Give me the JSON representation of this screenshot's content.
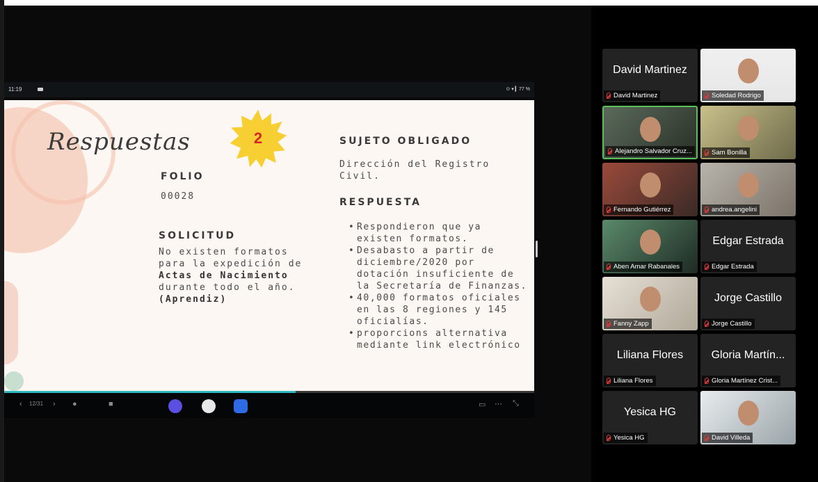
{
  "status_bar": {
    "time": "11:19",
    "right_icons": "⊙ ▾ ▎77 %"
  },
  "slide": {
    "script_title": "Respuestas",
    "number": "2",
    "folio_heading": "FOLIO",
    "folio_value": "00028",
    "solicitud_heading": "SOLICITUD",
    "solicitud_text_1": "No existen formatos para la expedición de ",
    "solicitud_bold_1": "Actas de Nacimiento",
    "solicitud_text_2": " durante todo el año.",
    "solicitud_author": "(Aprendiz)",
    "sujeto_heading": "SUJETO OBLIGADO",
    "sujeto_value": "Dirección del Registro Civil.",
    "respuesta_heading": "RESPUESTA",
    "respuesta_items": [
      "Respondieron que ya existen formatos.",
      "Desabasto a partir de diciembre/2020 por dotación insuficiente de la Secretaría de Finanzas.",
      "40,000 formatos oficiales en las 8 regiones y 145 oficialías.",
      "proporcions alternativa mediante link electrónico"
    ],
    "progress": 0.55
  },
  "navbar": {
    "page": "12/31",
    "canva": "Canva",
    "dots": "⋯"
  },
  "participants": [
    {
      "big": "David Martinez",
      "name": "David Martinez",
      "video": false
    },
    {
      "big": "",
      "name": "Soledad Rodrigo",
      "video": true
    },
    {
      "big": "",
      "name": "Alejandro Salvador Cruz...",
      "video": true,
      "active": true
    },
    {
      "big": "",
      "name": "Sam Bonilla",
      "video": true
    },
    {
      "big": "",
      "name": "Fernando Gutiérrez",
      "video": true
    },
    {
      "big": "",
      "name": "andrea.angelini",
      "video": true
    },
    {
      "big": "",
      "name": "Aben Amar Rabanales",
      "video": true
    },
    {
      "big": "Edgar Estrada",
      "name": "Edgar Estrada",
      "video": false
    },
    {
      "big": "",
      "name": "Fanny Zapp",
      "video": true
    },
    {
      "big": "Jorge Castillo",
      "name": "Jorge Castillo",
      "video": false
    },
    {
      "big": "Liliana Flores",
      "name": "Liliana Flores",
      "video": false
    },
    {
      "big": "Gloria Martín...",
      "name": "Gloria Martínez Crist...",
      "video": false
    },
    {
      "big": "Yesica HG",
      "name": "Yesica HG",
      "video": false
    },
    {
      "big": "",
      "name": "David Villeda",
      "video": true
    }
  ],
  "colors": {
    "active_speaker": "#5bc05b",
    "slide_bg": "#fdf7f3",
    "sun": "#f7cf32",
    "number": "#d72626",
    "progress": "#2fb8c0"
  }
}
